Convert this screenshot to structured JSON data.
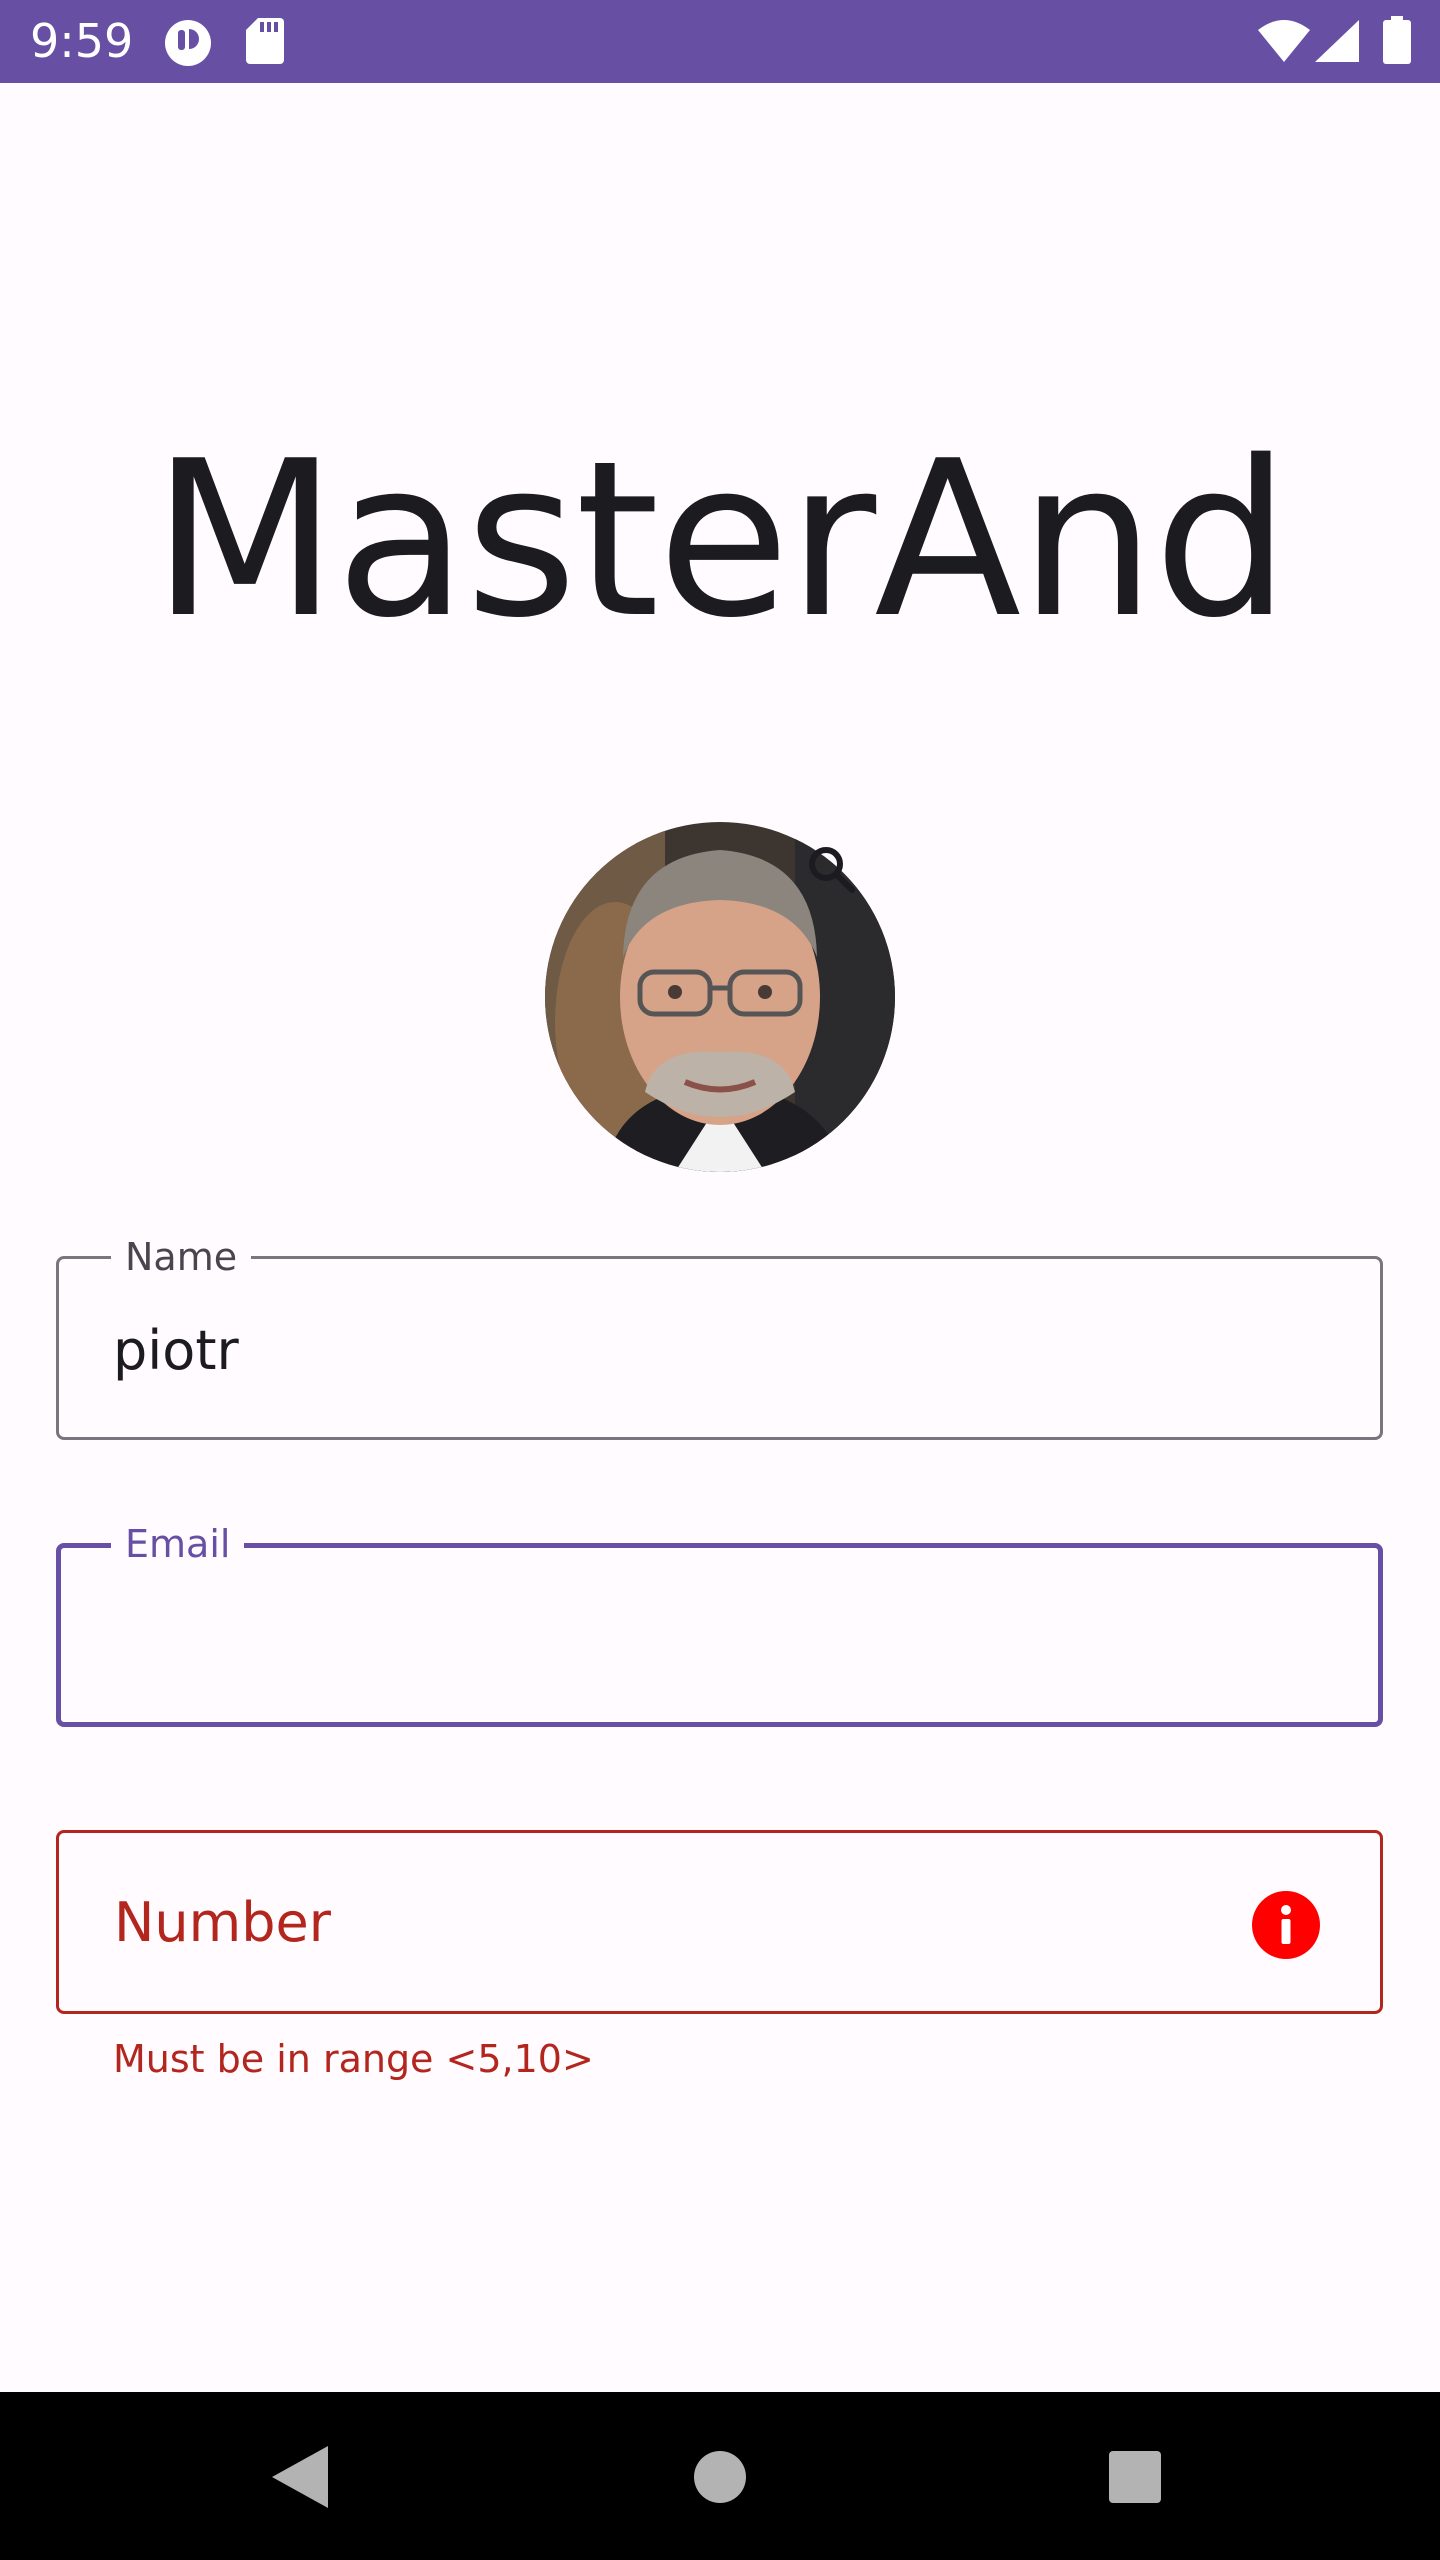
{
  "status_bar": {
    "time": "9:59",
    "icons": [
      "app-notification-icon",
      "sd-card-icon",
      "wifi-icon",
      "cellular-signal-icon",
      "battery-icon"
    ],
    "background": "#6750a4"
  },
  "app": {
    "title": "MasterAnd"
  },
  "avatar": {
    "alt": "Profile photo",
    "action_icon": "search-icon"
  },
  "form": {
    "name": {
      "label": "Name",
      "value": "piotr"
    },
    "email": {
      "label": "Email",
      "value": ""
    },
    "number": {
      "placeholder": "Number",
      "error": "Must be in range <5,10>",
      "icon": "error-info-icon"
    }
  },
  "navigation": {
    "buttons": [
      "back-icon",
      "home-icon",
      "recents-icon"
    ]
  },
  "colors": {
    "primary": "#6750a4",
    "error": "#b3261e",
    "error_icon": "#ff0000",
    "outline": "#79747e"
  }
}
